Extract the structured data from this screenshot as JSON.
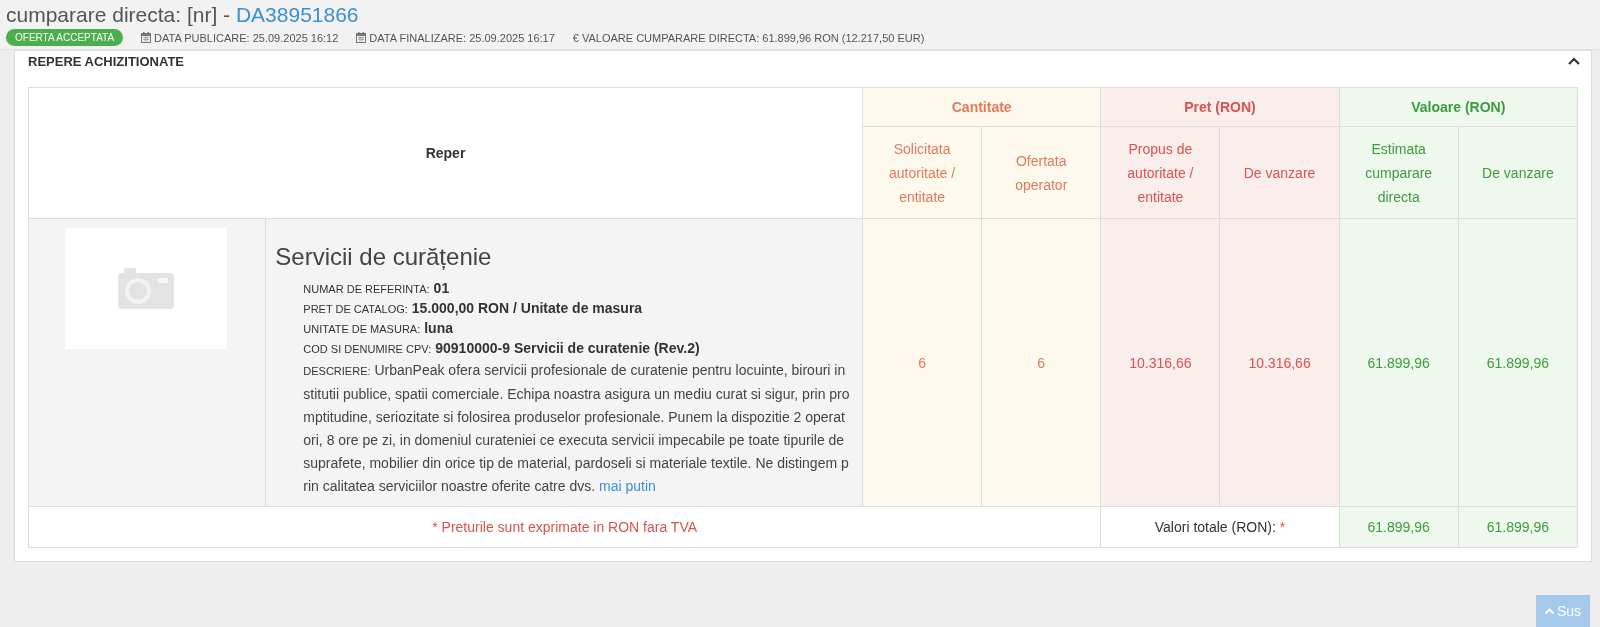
{
  "header": {
    "title_prefix": "cumparare directa: [nr] - ",
    "title_code": "DA38951866",
    "status": "OFERTA ACCEPTATA",
    "meta": [
      {
        "kind": "calendar",
        "text": "DATA PUBLICARE: 25.09.2025 16:12"
      },
      {
        "kind": "calendar",
        "text": "DATA FINALIZARE: 25.09.2025 16:17"
      },
      {
        "kind": "euro",
        "icon": "€",
        "text": "VALOARE CUMPARARE DIRECTA: 61.899,96  RON (12.217,50  EUR)"
      }
    ]
  },
  "panel": {
    "title": "REPERE ACHIZITIONATE",
    "expanded": true
  },
  "table": {
    "reper_header": "Reper",
    "groups": [
      {
        "kind": "quantity",
        "title": "Cantitate",
        "columns": [
          "Solicitata autoritate / entitate",
          "Ofertata operator"
        ]
      },
      {
        "kind": "price",
        "title": "Pret (RON)",
        "columns": [
          "Propus de autoritate / entitate",
          "De vanzare"
        ]
      },
      {
        "kind": "value",
        "title": "Valoare (RON)",
        "columns": [
          "Estimata cumparare directa",
          "De vanzare"
        ]
      }
    ],
    "rows": [
      {
        "name": "Servicii de curățenie",
        "fields": [
          {
            "label": "NUMAR DE REFERINTA:",
            "value": "01"
          },
          {
            "label": "PRET DE CATALOG:",
            "value": "15.000,00  RON / Unitate de masura"
          },
          {
            "label": "UNITATE DE MASURA:",
            "value": "luna"
          },
          {
            "label": "COD SI DENUMIRE CPV:",
            "value": "90910000-9 Servicii de curatenie (Rev.2)"
          }
        ],
        "description": {
          "label": "DESCRIERE:",
          "text": "UrbanPeak ofera servicii profesionale de curatenie pentru locuinte, birouri institutii publice, spatii comerciale. Echipa noastra asigura un mediu curat si sigur, prin promptitudine, seriozitate si folosirea produselor profesionale. Punem la dispozitie 2 operatori, 8 ore pe zi, in domeniul curateniei ce executa servicii impecabile pe toate tipurile de suprafete, mobilier din orice tip de material, pardoseli si materiale textile. Ne distingem prin calitatea serviciilor noastre oferite catre dvs.",
          "link": "mai putin"
        },
        "values": [
          "6",
          "6",
          "10.316,66",
          "10.316,66",
          "61.899,96",
          "61.899,96"
        ]
      }
    ],
    "footer": {
      "note": "* Preturile sunt exprimate in RON fara TVA",
      "total_label": "Valori totale (RON):",
      "total_mark": "*",
      "totals": [
        "61.899,96",
        "61.899,96"
      ]
    }
  },
  "scroll_top": {
    "label": "Sus"
  }
}
